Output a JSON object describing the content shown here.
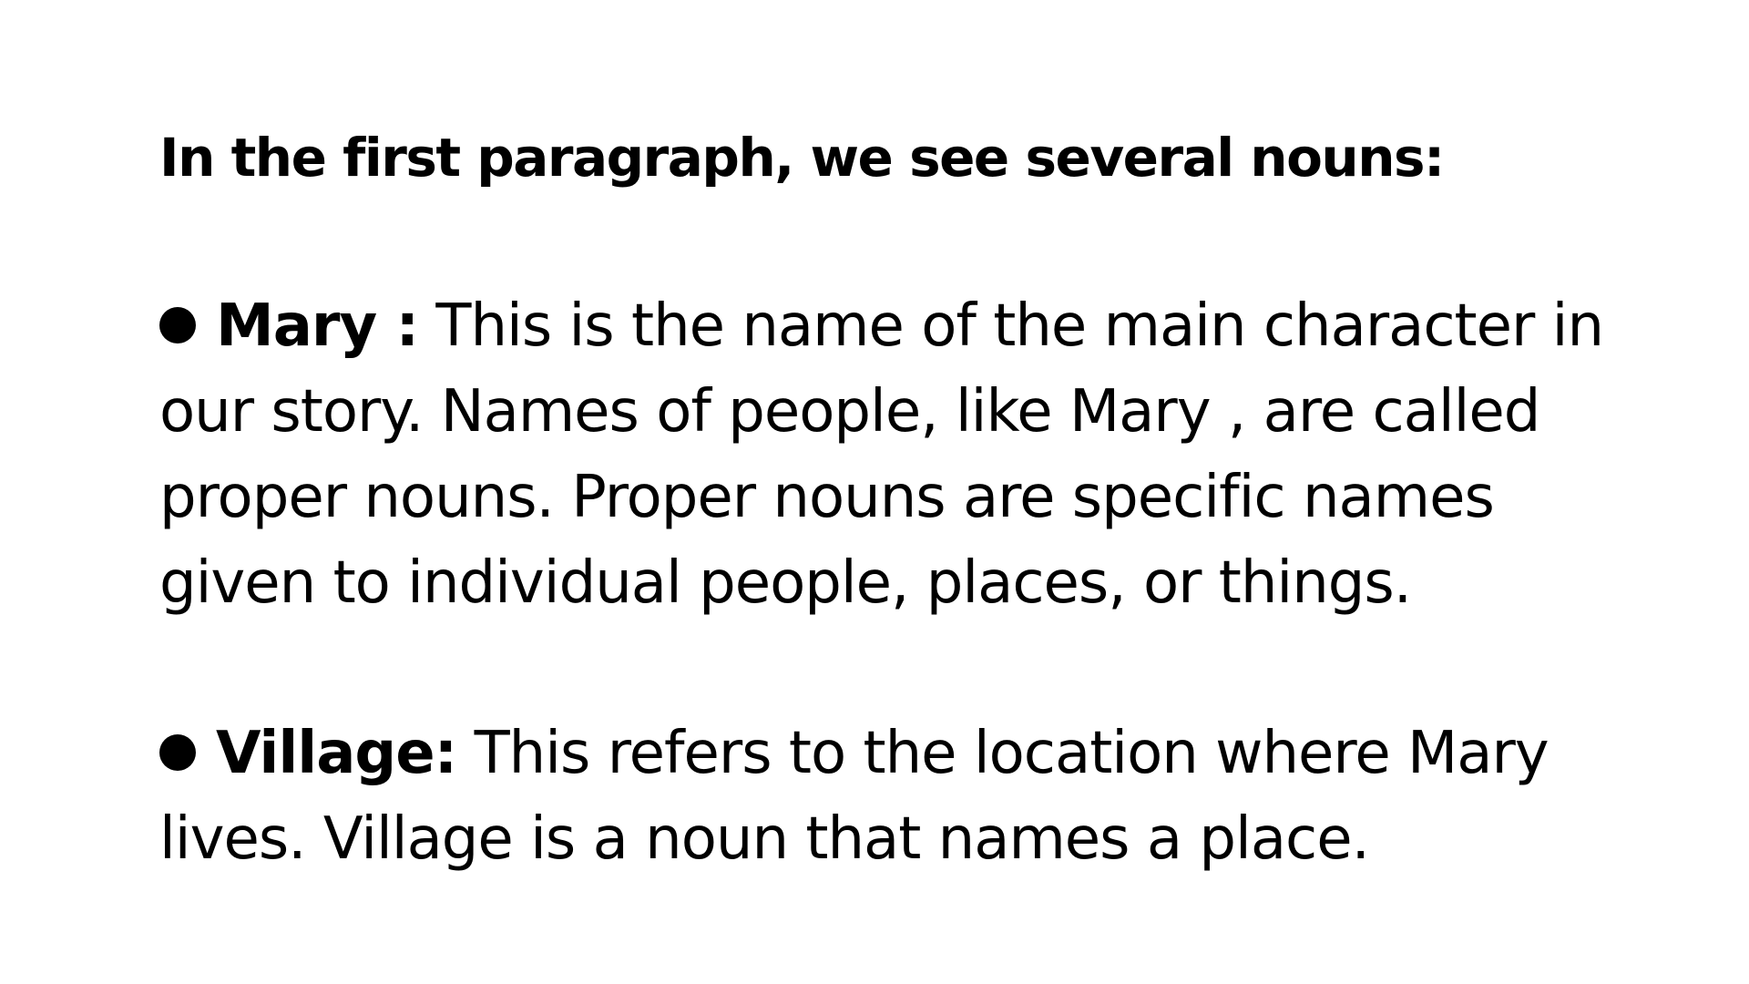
{
  "heading": "In the first paragraph, we see several nouns:",
  "bullets": [
    {
      "term": "Mary :",
      "description": "This is the name of the main character in our story. Names of people, like Mary , are called proper nouns. Proper nouns are specific names given to individual people, places, or things."
    },
    {
      "term": "Village:",
      "description": "This refers to the location where Mary lives. Village is a noun that names a place."
    }
  ],
  "colors": {
    "background": "#ffffff",
    "text": "#000000"
  }
}
